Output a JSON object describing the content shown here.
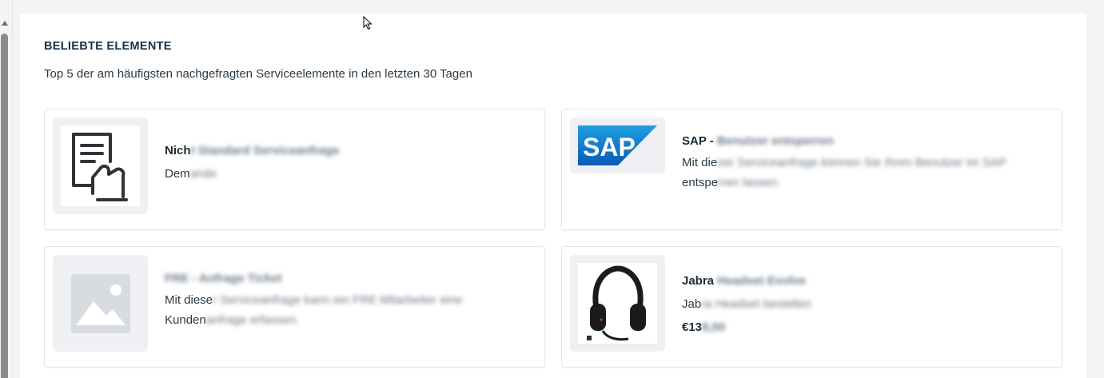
{
  "section": {
    "title": "BELIEBTE ELEMENTE",
    "subtitle": "Top 5 der am häufigsten nachgefragten Serviceelemente in den letzten 30 Tagen"
  },
  "cards": [
    {
      "icon": "document-hand-icon",
      "title_visible": "Nich",
      "title_blurred": "t Standard Serviceanfrage",
      "desc_visible": "Dem",
      "desc_blurred": "ande"
    },
    {
      "icon": "sap-logo",
      "logo_text": "SAP",
      "title_visible": "SAP - ",
      "title_blurred": "Benutzer entsperren",
      "desc_line1_visible": "Mit die",
      "desc_line1_blurred": "ser Serviceanfrage können Sie Ihren Benutzer im SAP",
      "desc_line2_visible": "entspe",
      "desc_line2_blurred": "rren lassen."
    },
    {
      "icon": "image-placeholder-icon",
      "title_visible": "",
      "title_blurred": "FRE - Anfrage Ticket",
      "desc_line1_visible": "Mit diese",
      "desc_line1_blurred": "r Serviceanfrage kann ein FRE Mitarbeiter eine",
      "desc_line2_visible": "Kunden",
      "desc_line2_blurred": "anfrage erfassen."
    },
    {
      "icon": "headset-icon",
      "title_visible": "Jabra ",
      "title_blurred": "Headset Evolve",
      "desc_visible": "Jab",
      "desc_blurred": "ra Headset bestellen",
      "price_visible": "€13",
      "price_blurred": "8,00"
    }
  ]
}
